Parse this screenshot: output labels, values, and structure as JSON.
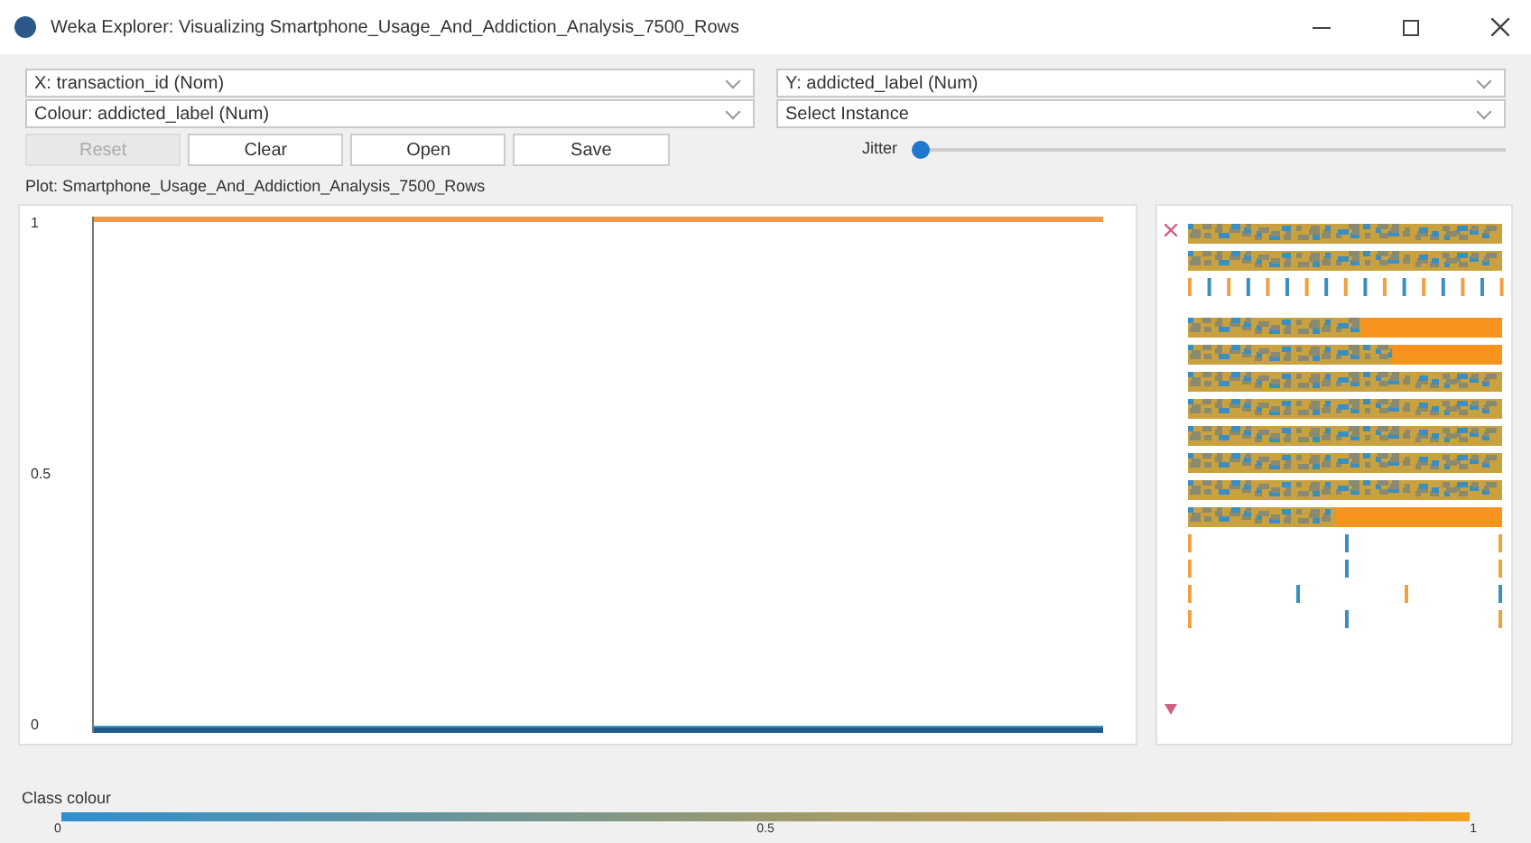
{
  "window": {
    "title": "Weka Explorer: Visualizing Smartphone_Usage_And_Addiction_Analysis_7500_Rows"
  },
  "selectors": [
    {
      "value": "X: transaction_id (Nom)"
    },
    {
      "value": "Y: addicted_label (Num)"
    },
    {
      "value": "Colour: addicted_label (Num)"
    },
    {
      "value": "Select Instance"
    }
  ],
  "buttons": [
    {
      "label": "Reset",
      "disabled": true
    },
    {
      "label": "Clear",
      "disabled": false
    },
    {
      "label": "Open",
      "disabled": false
    },
    {
      "label": "Save",
      "disabled": false
    }
  ],
  "jitter": {
    "label": "Jitter",
    "level": 0
  },
  "plot": {
    "title": "Plot: Smartphone_Usage_And_Addiction_Analysis_7500_Rows",
    "y_ticks": [
      "1",
      "0.5",
      "0"
    ]
  },
  "class_colour": {
    "title": "Class colour",
    "ticks": [
      "0",
      "0.5",
      "1"
    ]
  }
}
